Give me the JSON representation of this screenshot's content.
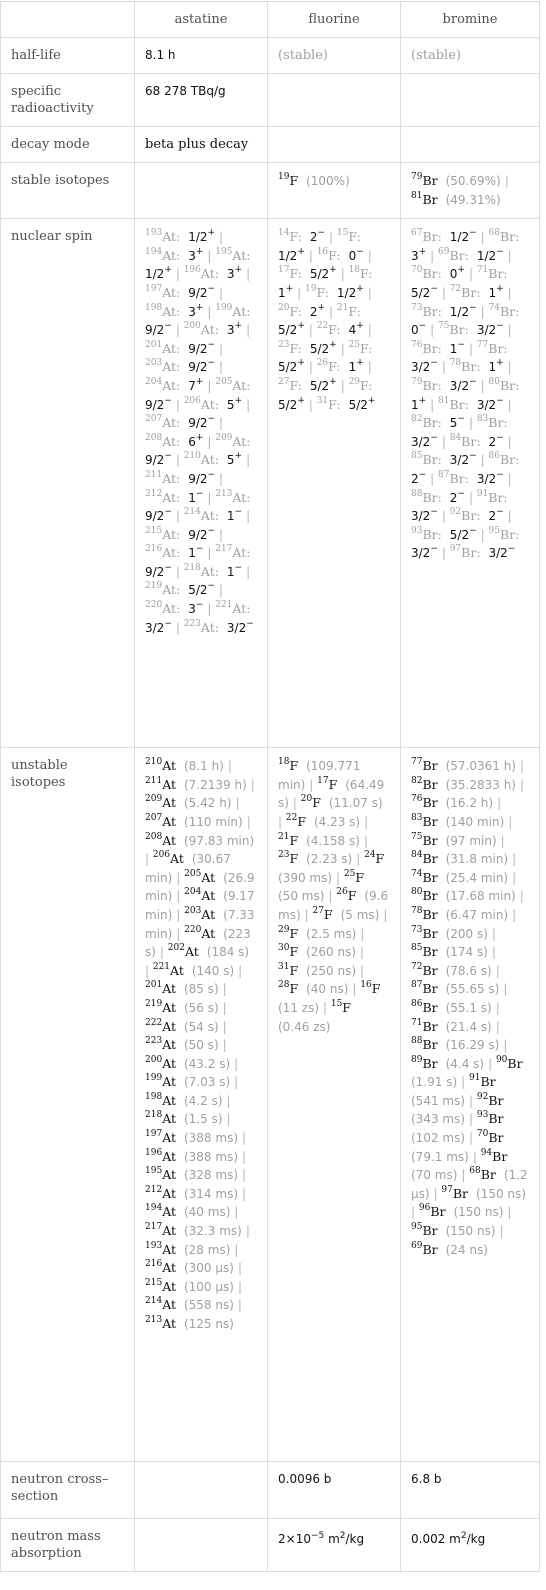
{
  "columns": [
    "",
    "astatine",
    "fluorine",
    "bromine"
  ],
  "rows": {
    "half_life": {
      "label": "half-life",
      "astatine": "8.1 h",
      "fluorine": "(stable)",
      "bromine": "(stable)"
    },
    "specific_radioactivity": {
      "label": "specific radioactivity",
      "astatine": "68 278 TBq/g",
      "fluorine": "",
      "bromine": ""
    },
    "decay_mode": {
      "label": "decay mode",
      "astatine": "beta plus decay",
      "fluorine": "",
      "bromine": ""
    },
    "stable_isotopes": {
      "label": "stable isotopes",
      "astatine": [],
      "fluorine": [
        {
          "mass": "19",
          "symbol": "F",
          "abundance": "(100%)"
        }
      ],
      "bromine": [
        {
          "mass": "79",
          "symbol": "Br",
          "abundance": "(50.69%)"
        },
        {
          "mass": "81",
          "symbol": "Br",
          "abundance": "(49.31%)"
        }
      ]
    },
    "nuclear_spin": {
      "label": "nuclear spin",
      "astatine": [
        {
          "mass": "193",
          "symbol": "At",
          "spin": "1/2",
          "parity": "+"
        },
        {
          "mass": "194",
          "symbol": "At",
          "spin": "3",
          "parity": "+"
        },
        {
          "mass": "195",
          "symbol": "At",
          "spin": "1/2",
          "parity": "+"
        },
        {
          "mass": "196",
          "symbol": "At",
          "spin": "3",
          "parity": "+"
        },
        {
          "mass": "197",
          "symbol": "At",
          "spin": "9/2",
          "parity": "−"
        },
        {
          "mass": "198",
          "symbol": "At",
          "spin": "3",
          "parity": "+"
        },
        {
          "mass": "199",
          "symbol": "At",
          "spin": "9/2",
          "parity": "−"
        },
        {
          "mass": "200",
          "symbol": "At",
          "spin": "3",
          "parity": "+"
        },
        {
          "mass": "201",
          "symbol": "At",
          "spin": "9/2",
          "parity": "−"
        },
        {
          "mass": "203",
          "symbol": "At",
          "spin": "9/2",
          "parity": "−"
        },
        {
          "mass": "204",
          "symbol": "At",
          "spin": "7",
          "parity": "+"
        },
        {
          "mass": "205",
          "symbol": "At",
          "spin": "9/2",
          "parity": "−"
        },
        {
          "mass": "206",
          "symbol": "At",
          "spin": "5",
          "parity": "+"
        },
        {
          "mass": "207",
          "symbol": "At",
          "spin": "9/2",
          "parity": "−"
        },
        {
          "mass": "208",
          "symbol": "At",
          "spin": "6",
          "parity": "+"
        },
        {
          "mass": "209",
          "symbol": "At",
          "spin": "9/2",
          "parity": "−"
        },
        {
          "mass": "210",
          "symbol": "At",
          "spin": "5",
          "parity": "+"
        },
        {
          "mass": "211",
          "symbol": "At",
          "spin": "9/2",
          "parity": "−"
        },
        {
          "mass": "212",
          "symbol": "At",
          "spin": "1",
          "parity": "−"
        },
        {
          "mass": "213",
          "symbol": "At",
          "spin": "9/2",
          "parity": "−"
        },
        {
          "mass": "214",
          "symbol": "At",
          "spin": "1",
          "parity": "−"
        },
        {
          "mass": "215",
          "symbol": "At",
          "spin": "9/2",
          "parity": "−"
        },
        {
          "mass": "216",
          "symbol": "At",
          "spin": "1",
          "parity": "−"
        },
        {
          "mass": "217",
          "symbol": "At",
          "spin": "9/2",
          "parity": "−"
        },
        {
          "mass": "218",
          "symbol": "At",
          "spin": "1",
          "parity": "−"
        },
        {
          "mass": "219",
          "symbol": "At",
          "spin": "5/2",
          "parity": "−"
        },
        {
          "mass": "220",
          "symbol": "At",
          "spin": "3",
          "parity": "−"
        },
        {
          "mass": "221",
          "symbol": "At",
          "spin": "3/2",
          "parity": "−"
        },
        {
          "mass": "223",
          "symbol": "At",
          "spin": "3/2",
          "parity": "−"
        }
      ],
      "fluorine": [
        {
          "mass": "14",
          "symbol": "F",
          "spin": "2",
          "parity": "−"
        },
        {
          "mass": "15",
          "symbol": "F",
          "spin": "1/2",
          "parity": "+"
        },
        {
          "mass": "16",
          "symbol": "F",
          "spin": "0",
          "parity": "−"
        },
        {
          "mass": "17",
          "symbol": "F",
          "spin": "5/2",
          "parity": "+"
        },
        {
          "mass": "18",
          "symbol": "F",
          "spin": "1",
          "parity": "+"
        },
        {
          "mass": "19",
          "symbol": "F",
          "spin": "1/2",
          "parity": "+"
        },
        {
          "mass": "20",
          "symbol": "F",
          "spin": "2",
          "parity": "+"
        },
        {
          "mass": "21",
          "symbol": "F",
          "spin": "5/2",
          "parity": "+"
        },
        {
          "mass": "22",
          "symbol": "F",
          "spin": "4",
          "parity": "+"
        },
        {
          "mass": "23",
          "symbol": "F",
          "spin": "5/2",
          "parity": "+"
        },
        {
          "mass": "25",
          "symbol": "F",
          "spin": "5/2",
          "parity": "+"
        },
        {
          "mass": "26",
          "symbol": "F",
          "spin": "1",
          "parity": "+"
        },
        {
          "mass": "27",
          "symbol": "F",
          "spin": "5/2",
          "parity": "+"
        },
        {
          "mass": "29",
          "symbol": "F",
          "spin": "5/2",
          "parity": "+"
        },
        {
          "mass": "31",
          "symbol": "F",
          "spin": "5/2",
          "parity": "+"
        }
      ],
      "bromine": [
        {
          "mass": "67",
          "symbol": "Br",
          "spin": "1/2",
          "parity": "−"
        },
        {
          "mass": "68",
          "symbol": "Br",
          "spin": "3",
          "parity": "+"
        },
        {
          "mass": "69",
          "symbol": "Br",
          "spin": "1/2",
          "parity": "−"
        },
        {
          "mass": "70",
          "symbol": "Br",
          "spin": "0",
          "parity": "+"
        },
        {
          "mass": "71",
          "symbol": "Br",
          "spin": "5/2",
          "parity": "−"
        },
        {
          "mass": "72",
          "symbol": "Br",
          "spin": "1",
          "parity": "+"
        },
        {
          "mass": "73",
          "symbol": "Br",
          "spin": "1/2",
          "parity": "−"
        },
        {
          "mass": "74",
          "symbol": "Br",
          "spin": "0",
          "parity": "−"
        },
        {
          "mass": "75",
          "symbol": "Br",
          "spin": "3/2",
          "parity": "−"
        },
        {
          "mass": "76",
          "symbol": "Br",
          "spin": "1",
          "parity": "−"
        },
        {
          "mass": "77",
          "symbol": "Br",
          "spin": "3/2",
          "parity": "−"
        },
        {
          "mass": "78",
          "symbol": "Br",
          "spin": "1",
          "parity": "+"
        },
        {
          "mass": "79",
          "symbol": "Br",
          "spin": "3/2",
          "parity": "−"
        },
        {
          "mass": "80",
          "symbol": "Br",
          "spin": "1",
          "parity": "+"
        },
        {
          "mass": "81",
          "symbol": "Br",
          "spin": "3/2",
          "parity": "−"
        },
        {
          "mass": "82",
          "symbol": "Br",
          "spin": "5",
          "parity": "−"
        },
        {
          "mass": "83",
          "symbol": "Br",
          "spin": "3/2",
          "parity": "−"
        },
        {
          "mass": "84",
          "symbol": "Br",
          "spin": "2",
          "parity": "−"
        },
        {
          "mass": "85",
          "symbol": "Br",
          "spin": "3/2",
          "parity": "−"
        },
        {
          "mass": "86",
          "symbol": "Br",
          "spin": "2",
          "parity": "−"
        },
        {
          "mass": "87",
          "symbol": "Br",
          "spin": "3/2",
          "parity": "−"
        },
        {
          "mass": "88",
          "symbol": "Br",
          "spin": "2",
          "parity": "−"
        },
        {
          "mass": "91",
          "symbol": "Br",
          "spin": "3/2",
          "parity": "−"
        },
        {
          "mass": "92",
          "symbol": "Br",
          "spin": "2",
          "parity": "−"
        },
        {
          "mass": "93",
          "symbol": "Br",
          "spin": "5/2",
          "parity": "−"
        },
        {
          "mass": "95",
          "symbol": "Br",
          "spin": "3/2",
          "parity": "−"
        },
        {
          "mass": "97",
          "symbol": "Br",
          "spin": "3/2",
          "parity": "−"
        }
      ]
    },
    "unstable_isotopes": {
      "label": "unstable isotopes",
      "astatine": [
        {
          "mass": "210",
          "symbol": "At",
          "half_life": "(8.1 h)"
        },
        {
          "mass": "211",
          "symbol": "At",
          "half_life": "(7.2139 h)"
        },
        {
          "mass": "209",
          "symbol": "At",
          "half_life": "(5.42 h)"
        },
        {
          "mass": "207",
          "symbol": "At",
          "half_life": "(110 min)"
        },
        {
          "mass": "208",
          "symbol": "At",
          "half_life": "(97.83 min)"
        },
        {
          "mass": "206",
          "symbol": "At",
          "half_life": "(30.67 min)"
        },
        {
          "mass": "205",
          "symbol": "At",
          "half_life": "(26.9 min)"
        },
        {
          "mass": "204",
          "symbol": "At",
          "half_life": "(9.17 min)"
        },
        {
          "mass": "203",
          "symbol": "At",
          "half_life": "(7.33 min)"
        },
        {
          "mass": "220",
          "symbol": "At",
          "half_life": "(223 s)"
        },
        {
          "mass": "202",
          "symbol": "At",
          "half_life": "(184 s)"
        },
        {
          "mass": "221",
          "symbol": "At",
          "half_life": "(140 s)"
        },
        {
          "mass": "201",
          "symbol": "At",
          "half_life": "(85 s)"
        },
        {
          "mass": "219",
          "symbol": "At",
          "half_life": "(56 s)"
        },
        {
          "mass": "222",
          "symbol": "At",
          "half_life": "(54 s)"
        },
        {
          "mass": "223",
          "symbol": "At",
          "half_life": "(50 s)"
        },
        {
          "mass": "200",
          "symbol": "At",
          "half_life": "(43.2 s)"
        },
        {
          "mass": "199",
          "symbol": "At",
          "half_life": "(7.03 s)"
        },
        {
          "mass": "198",
          "symbol": "At",
          "half_life": "(4.2 s)"
        },
        {
          "mass": "218",
          "symbol": "At",
          "half_life": "(1.5 s)"
        },
        {
          "mass": "197",
          "symbol": "At",
          "half_life": "(388 ms)"
        },
        {
          "mass": "196",
          "symbol": "At",
          "half_life": "(388 ms)"
        },
        {
          "mass": "195",
          "symbol": "At",
          "half_life": "(328 ms)"
        },
        {
          "mass": "212",
          "symbol": "At",
          "half_life": "(314 ms)"
        },
        {
          "mass": "194",
          "symbol": "At",
          "half_life": "(40 ms)"
        },
        {
          "mass": "217",
          "symbol": "At",
          "half_life": "(32.3 ms)"
        },
        {
          "mass": "193",
          "symbol": "At",
          "half_life": "(28 ms)"
        },
        {
          "mass": "216",
          "symbol": "At",
          "half_life": "(300 µs)"
        },
        {
          "mass": "215",
          "symbol": "At",
          "half_life": "(100 µs)"
        },
        {
          "mass": "214",
          "symbol": "At",
          "half_life": "(558 ns)"
        },
        {
          "mass": "213",
          "symbol": "At",
          "half_life": "(125 ns)"
        }
      ],
      "fluorine": [
        {
          "mass": "18",
          "symbol": "F",
          "half_life": "(109.771 min)"
        },
        {
          "mass": "17",
          "symbol": "F",
          "half_life": "(64.49 s)"
        },
        {
          "mass": "20",
          "symbol": "F",
          "half_life": "(11.07 s)"
        },
        {
          "mass": "22",
          "symbol": "F",
          "half_life": "(4.23 s)"
        },
        {
          "mass": "21",
          "symbol": "F",
          "half_life": "(4.158 s)"
        },
        {
          "mass": "23",
          "symbol": "F",
          "half_life": "(2.23 s)"
        },
        {
          "mass": "24",
          "symbol": "F",
          "half_life": "(390 ms)"
        },
        {
          "mass": "25",
          "symbol": "F",
          "half_life": "(50 ms)"
        },
        {
          "mass": "26",
          "symbol": "F",
          "half_life": "(9.6 ms)"
        },
        {
          "mass": "27",
          "symbol": "F",
          "half_life": "(5 ms)"
        },
        {
          "mass": "29",
          "symbol": "F",
          "half_life": "(2.5 ms)"
        },
        {
          "mass": "30",
          "symbol": "F",
          "half_life": "(260 ns)"
        },
        {
          "mass": "31",
          "symbol": "F",
          "half_life": "(250 ns)"
        },
        {
          "mass": "28",
          "symbol": "F",
          "half_life": "(40 ns)"
        },
        {
          "mass": "16",
          "symbol": "F",
          "half_life": "(11 zs)"
        },
        {
          "mass": "15",
          "symbol": "F",
          "half_life": "(0.46 zs)"
        }
      ],
      "bromine": [
        {
          "mass": "77",
          "symbol": "Br",
          "half_life": "(57.0361 h)"
        },
        {
          "mass": "82",
          "symbol": "Br",
          "half_life": "(35.2833 h)"
        },
        {
          "mass": "76",
          "symbol": "Br",
          "half_life": "(16.2 h)"
        },
        {
          "mass": "83",
          "symbol": "Br",
          "half_life": "(140 min)"
        },
        {
          "mass": "75",
          "symbol": "Br",
          "half_life": "(97 min)"
        },
        {
          "mass": "84",
          "symbol": "Br",
          "half_life": "(31.8 min)"
        },
        {
          "mass": "74",
          "symbol": "Br",
          "half_life": "(25.4 min)"
        },
        {
          "mass": "80",
          "symbol": "Br",
          "half_life": "(17.68 min)"
        },
        {
          "mass": "78",
          "symbol": "Br",
          "half_life": "(6.47 min)"
        },
        {
          "mass": "73",
          "symbol": "Br",
          "half_life": "(200 s)"
        },
        {
          "mass": "85",
          "symbol": "Br",
          "half_life": "(174 s)"
        },
        {
          "mass": "72",
          "symbol": "Br",
          "half_life": "(78.6 s)"
        },
        {
          "mass": "87",
          "symbol": "Br",
          "half_life": "(55.65 s)"
        },
        {
          "mass": "86",
          "symbol": "Br",
          "half_life": "(55.1 s)"
        },
        {
          "mass": "71",
          "symbol": "Br",
          "half_life": "(21.4 s)"
        },
        {
          "mass": "88",
          "symbol": "Br",
          "half_life": "(16.29 s)"
        },
        {
          "mass": "89",
          "symbol": "Br",
          "half_life": "(4.4 s)"
        },
        {
          "mass": "90",
          "symbol": "Br",
          "half_life": "(1.91 s)"
        },
        {
          "mass": "91",
          "symbol": "Br",
          "half_life": "(541 ms)"
        },
        {
          "mass": "92",
          "symbol": "Br",
          "half_life": "(343 ms)"
        },
        {
          "mass": "93",
          "symbol": "Br",
          "half_life": "(102 ms)"
        },
        {
          "mass": "70",
          "symbol": "Br",
          "half_life": "(79.1 ms)"
        },
        {
          "mass": "94",
          "symbol": "Br",
          "half_life": "(70 ms)"
        },
        {
          "mass": "68",
          "symbol": "Br",
          "half_life": "(1.2 µs)"
        },
        {
          "mass": "97",
          "symbol": "Br",
          "half_life": "(150 ns)"
        },
        {
          "mass": "96",
          "symbol": "Br",
          "half_life": "(150 ns)"
        },
        {
          "mass": "95",
          "symbol": "Br",
          "half_life": "(150 ns)"
        },
        {
          "mass": "69",
          "symbol": "Br",
          "half_life": "(24 ns)"
        }
      ]
    },
    "neutron_cross_section": {
      "label": "neutron cross–section",
      "astatine": "",
      "fluorine": "0.0096 b",
      "bromine": "6.8 b"
    },
    "neutron_mass_absorption": {
      "label": "neutron mass absorption",
      "astatine": "",
      "fluorine": {
        "mantissa": "2×10",
        "exponent": "−5",
        "unit": " m",
        "unit_exp": "2",
        "unit_tail": "/kg"
      },
      "bromine": {
        "mantissa": "0.002",
        "exponent": "",
        "unit": " m",
        "unit_exp": "2",
        "unit_tail": "/kg"
      }
    }
  }
}
